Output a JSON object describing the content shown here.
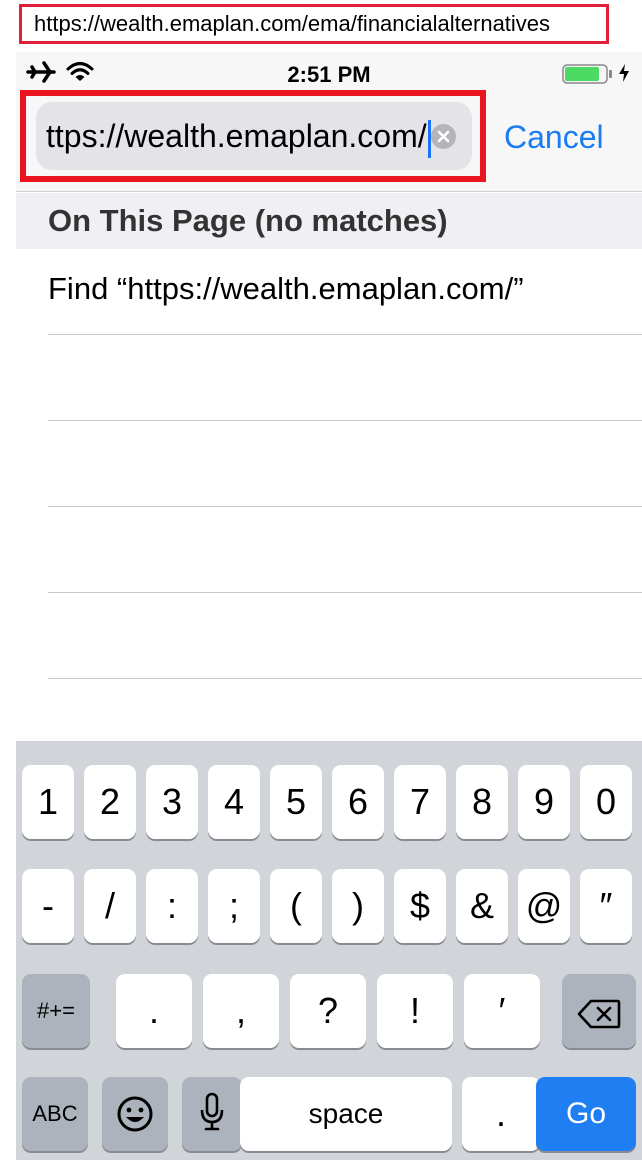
{
  "annotation": {
    "url_text": "https://wealth.emaplan.com/ema/financialalternatives"
  },
  "status_bar": {
    "time": "2:51 PM",
    "airplane_icon": "airplane-icon",
    "wifi_icon": "wifi-icon",
    "battery_icon": "battery-icon",
    "charging_icon": "charging-bolt-icon",
    "battery_level": 0.85,
    "battery_color": "#4cd964"
  },
  "search": {
    "value": "ttps://wealth.emaplan.com/",
    "clear_icon": "clear-circle-icon",
    "cancel_label": "Cancel",
    "accent_color": "#1a7cf0",
    "highlight_color": "#e8141e"
  },
  "results": {
    "section_title": "On This Page (no matches)",
    "items": [
      {
        "label": "Find “https://wealth.emaplan.com/”"
      },
      {
        "label": ""
      },
      {
        "label": ""
      },
      {
        "label": ""
      },
      {
        "label": ""
      }
    ]
  },
  "keyboard": {
    "row1": [
      "1",
      "2",
      "3",
      "4",
      "5",
      "6",
      "7",
      "8",
      "9",
      "0"
    ],
    "row2": [
      "-",
      "/",
      ":",
      ";",
      "(",
      ")",
      "$",
      "&",
      "@",
      "″"
    ],
    "row3_left": "#+=",
    "row3": [
      ".",
      ",",
      "?",
      "!",
      "′"
    ],
    "row3_right_icon": "delete-backspace-icon",
    "row4_abc": "ABC",
    "row4_emoji_icon": "emoji-icon",
    "row4_mic_icon": "microphone-icon",
    "row4_space": "space",
    "row4_period": ".",
    "row4_go": "Go",
    "go_color": "#1e7ef2"
  }
}
